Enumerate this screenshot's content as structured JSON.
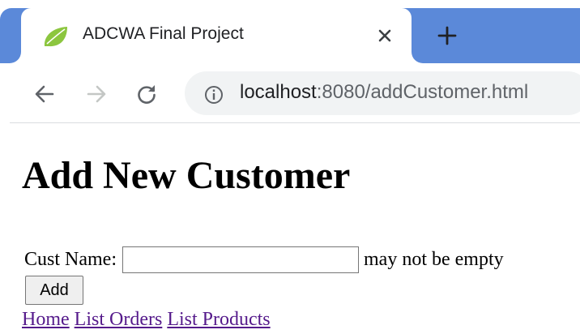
{
  "browser": {
    "tab": {
      "title": "ADCWA Final Project",
      "favicon": "spring-leaf-icon"
    },
    "icons": {
      "close": "close-icon",
      "new_tab": "plus-icon",
      "back": "back-arrow-icon",
      "forward": "forward-arrow-icon",
      "reload": "reload-icon",
      "site_info": "info-icon"
    },
    "url": {
      "host": "localhost",
      "rest": ":8080/addCustomer.html"
    },
    "colors": {
      "tabstrip": "#5b89d9",
      "omnibox": "#f1f3f4"
    }
  },
  "page": {
    "title": "Add New Customer",
    "form": {
      "cust_name_label": "Cust Name:",
      "cust_name_value": "",
      "error_message": "may not be empty",
      "submit_label": "Add"
    },
    "links": [
      {
        "label": "Home"
      },
      {
        "label": "List Orders"
      },
      {
        "label": "List Products"
      }
    ],
    "colors": {
      "visited_link": "#551a8b"
    }
  }
}
